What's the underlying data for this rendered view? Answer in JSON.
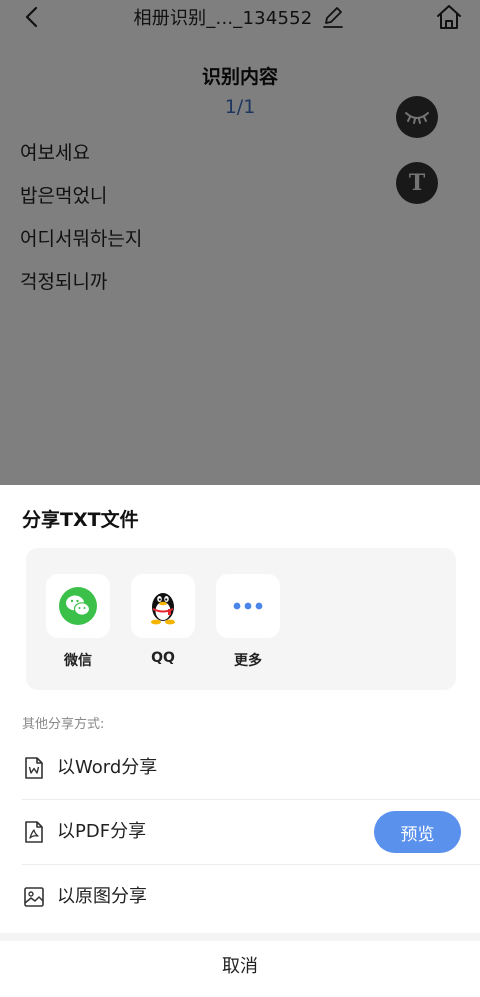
{
  "header": {
    "title": "相册识别_..._134552"
  },
  "content": {
    "heading": "识别内容",
    "pager": "1/1",
    "lines": [
      "여보세요",
      "밥은먹었니",
      "어디서뭐하는지",
      "걱정되니까"
    ]
  },
  "floating": {
    "text_toggle": "T"
  },
  "sheet": {
    "title": "分享TXT文件",
    "share_targets": [
      {
        "label": "微信",
        "icon": "wechat-icon"
      },
      {
        "label": "QQ",
        "icon": "qq-icon"
      },
      {
        "label": "更多",
        "icon": "more-icon"
      }
    ],
    "other_label": "其他分享方式:",
    "options": [
      {
        "label": "以Word分享",
        "icon": "word-file-icon"
      },
      {
        "label": "以PDF分享",
        "icon": "pdf-file-icon"
      },
      {
        "label": "以原图分享",
        "icon": "image-icon"
      }
    ],
    "preview_label": "预览",
    "cancel_label": "取消"
  },
  "colors": {
    "accent": "#5a91ec",
    "pager": "#3f6ec0",
    "wechat": "#3bc14a",
    "overlay": "rgba(0,0,0,0.5)"
  }
}
